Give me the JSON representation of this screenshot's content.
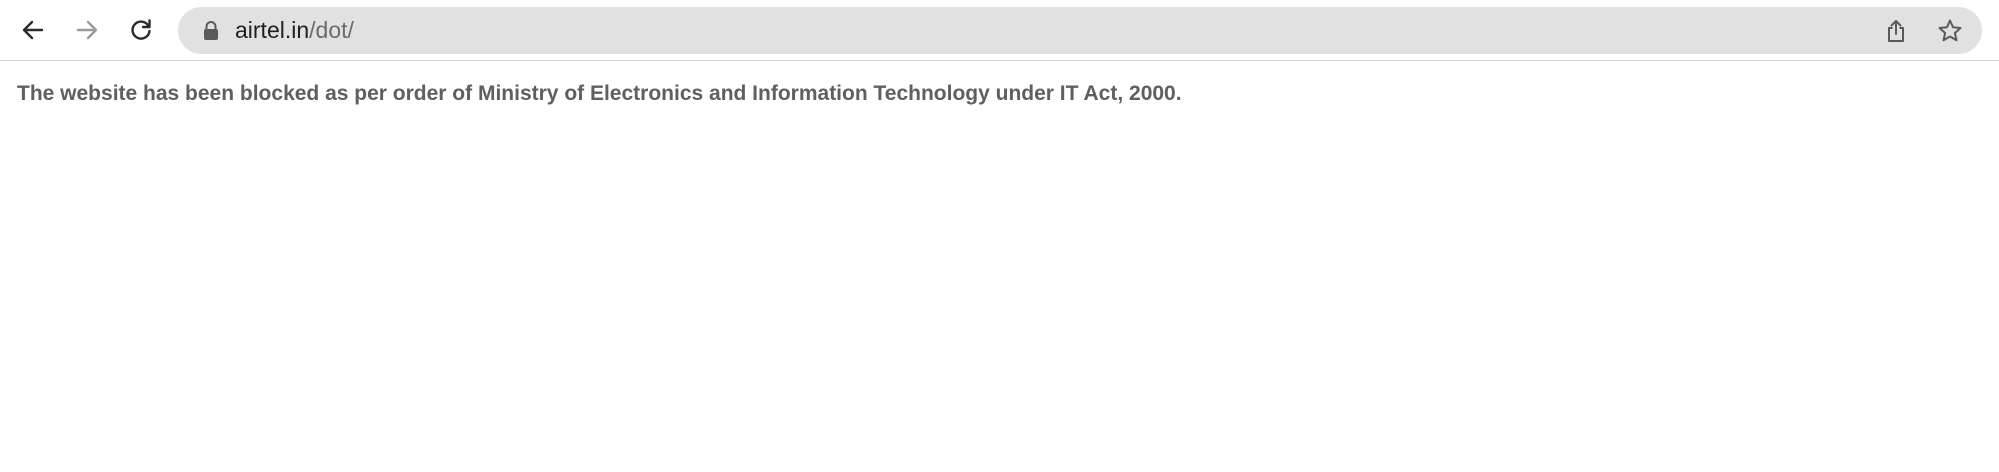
{
  "browser": {
    "url_host": "airtel.in",
    "url_path": "/dot/",
    "icons": {
      "back": "arrow-left-icon",
      "forward": "arrow-right-icon",
      "reload": "reload-icon",
      "lock": "lock-icon",
      "share": "share-icon",
      "bookmark": "star-icon"
    }
  },
  "page": {
    "message": "The website has been blocked as per order of Ministry of Electronics and Information Technology under IT Act, 2000."
  },
  "colors": {
    "omnibox_bg": "#e1e1e1",
    "message_text": "#5f5f5f"
  }
}
